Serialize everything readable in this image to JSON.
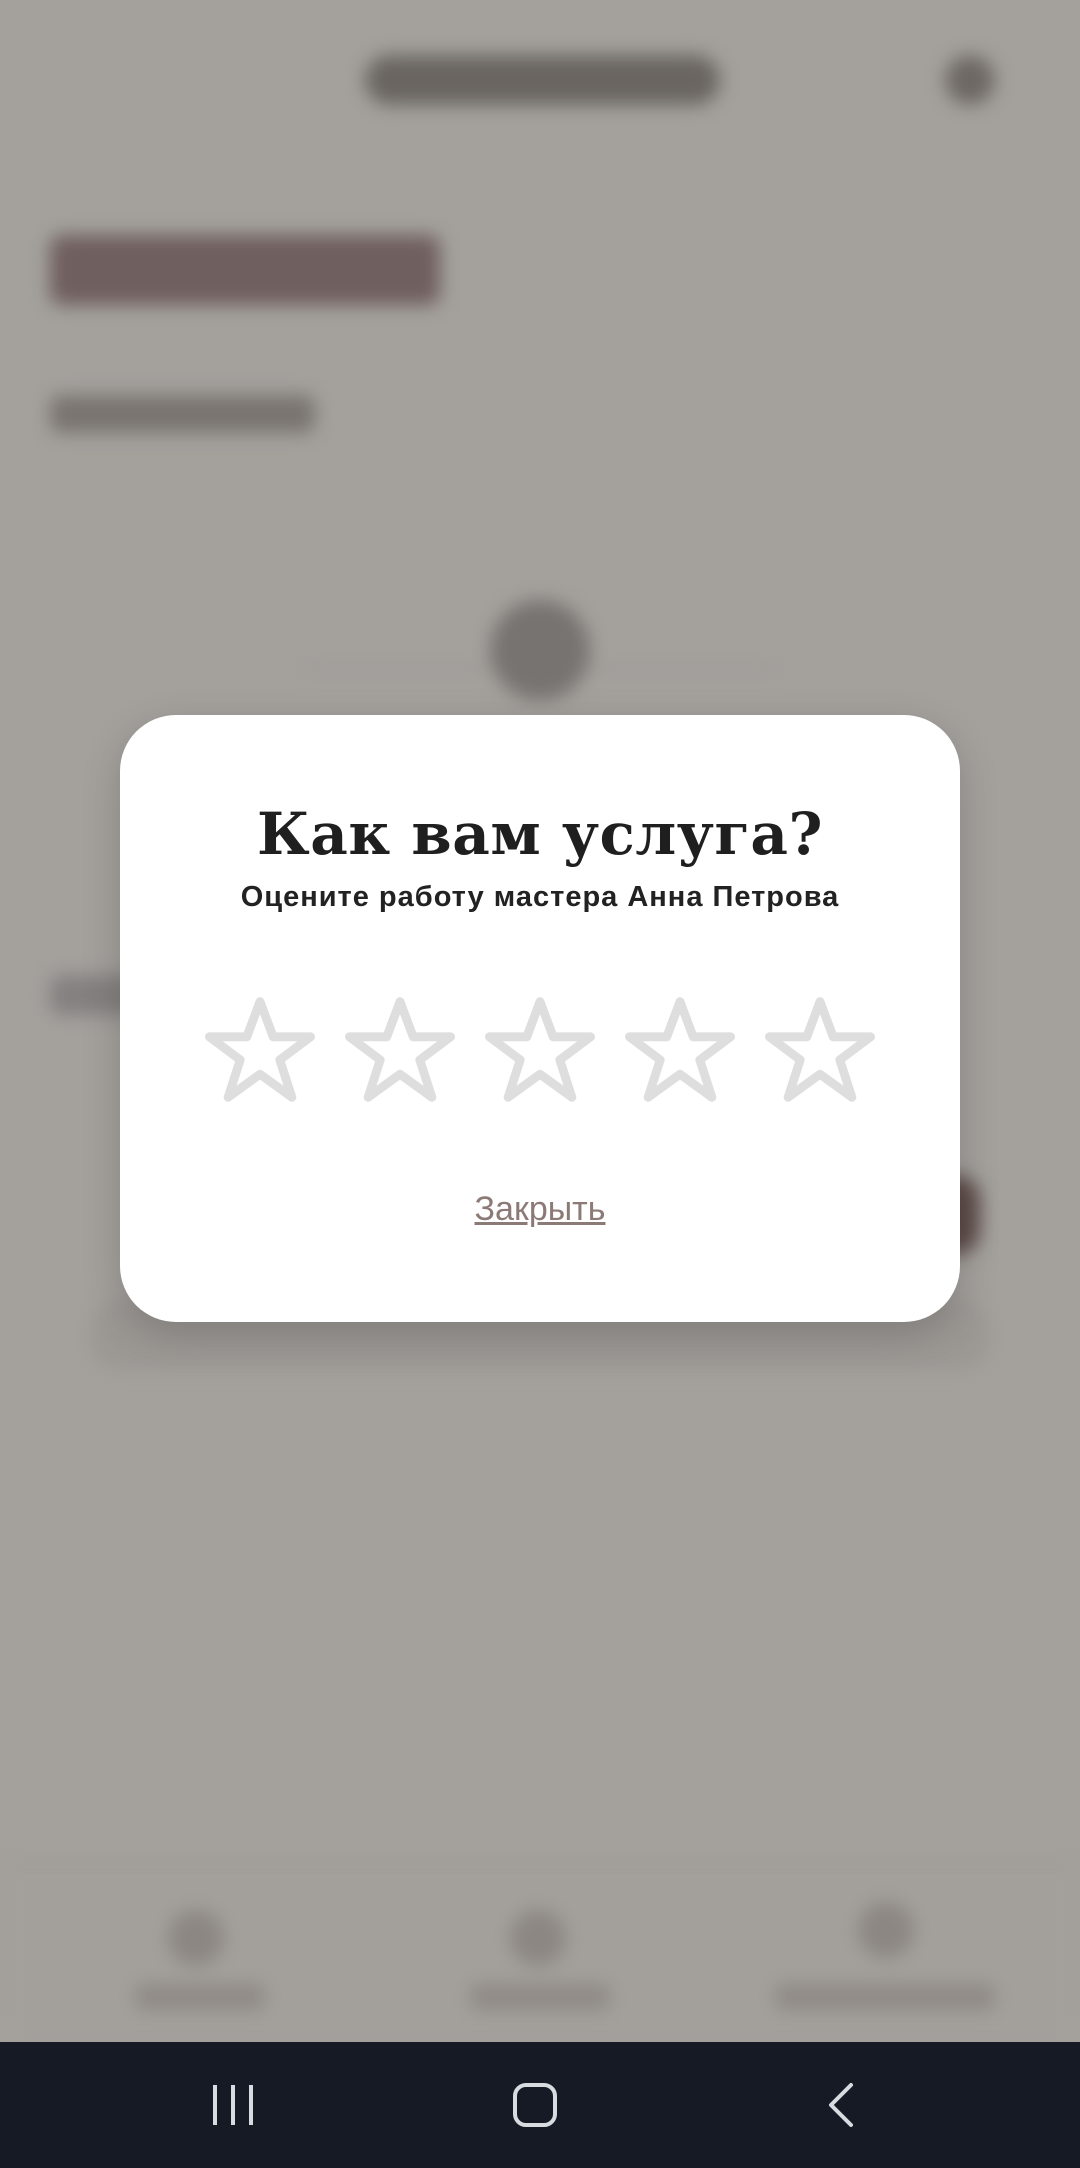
{
  "dialog": {
    "title": "Как вам услуга?",
    "subtitle": "Оцените работу мастера Анна Петрова",
    "rating": {
      "value": 0,
      "max": 5
    },
    "close_label": "Закрыть"
  },
  "system_nav": {
    "buttons": [
      "recent-apps",
      "home",
      "back"
    ]
  },
  "colors": {
    "overlay_background": "#a4a19d",
    "dialog_background": "#ffffff",
    "star_outline": "#dedede",
    "close_link": "#8c7a77",
    "system_nav_background": "#151a24"
  }
}
